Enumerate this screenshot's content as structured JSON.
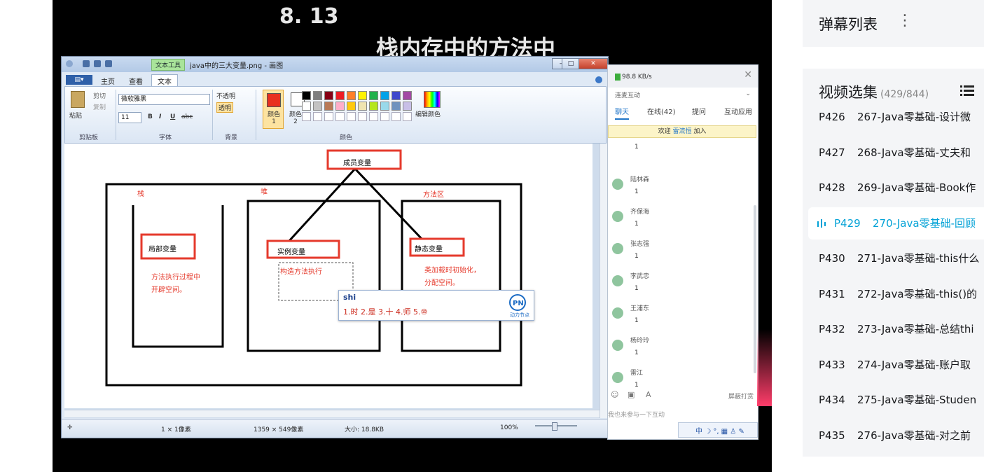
{
  "video": {
    "title_line1": "8. 13",
    "title_line2": "栈内存中的方法中",
    "paint": {
      "window_title": "java中的三大变量.png - 画图",
      "context_tab": "文本工具",
      "file_tab": "▤▾",
      "tabs": [
        "主页",
        "查看",
        "文本"
      ],
      "clipboard": {
        "paste": "粘贴",
        "cut": "剪切",
        "copy": "复制",
        "label": "剪贴板"
      },
      "font": {
        "family": "微软雅黑",
        "size": "11",
        "label": "字体",
        "bold": "B",
        "italic": "I",
        "underline": "U",
        "strike": "abc"
      },
      "background": {
        "opaque": "不透明",
        "transparent": "透明",
        "label": "背景"
      },
      "colors": {
        "color1": "颜色 1",
        "color2": "颜色 2",
        "edit": "编辑颜色",
        "label": "颜色",
        "palette": [
          "#000000",
          "#7f7f7f",
          "#880015",
          "#ed1c24",
          "#ff7f27",
          "#fff200",
          "#22b14c",
          "#00a2e8",
          "#3f48cc",
          "#a349a4",
          "#ffffff",
          "#c3c3c3",
          "#b97a57",
          "#ffaec9",
          "#ffc90e",
          "#efe4b0",
          "#b5e61d",
          "#99d9ea",
          "#7092be",
          "#c8bfe7"
        ]
      },
      "diagram": {
        "member": "成员变量",
        "stack": "栈",
        "heap": "堆",
        "method_area": "方法区",
        "local": "局部变量",
        "instance": "实例变量",
        "static": "静态变量",
        "local_desc1": "方法执行过程中",
        "local_desc2": "开辟空间。",
        "instance_desc": "构造方法执行",
        "static_desc1": "类加载时初始化，",
        "static_desc2": "分配空间。"
      },
      "ime": {
        "pinyin": "shi",
        "candidates": "1.时  2.是  3.十  4.师  5.⑩",
        "brand": "动力节点"
      },
      "status": {
        "pos": "1 × 1像素",
        "size": "1359 × 549像素",
        "file": "大小: 18.8KB",
        "zoom": "100%"
      }
    },
    "chat": {
      "speed": "98.8 KB/s",
      "subtitle": "连麦互动",
      "tabs": [
        "聊天",
        "在线(42)",
        "提问",
        "互动应用"
      ],
      "welcome_pre": "欢迎",
      "welcome_name": "雷流恒",
      "welcome_post": "加入",
      "messages": [
        {
          "name": "",
          "text": "1"
        },
        {
          "name": "陆林森",
          "text": "1"
        },
        {
          "name": "齐保海",
          "text": "1"
        },
        {
          "name": "张志强",
          "text": "1"
        },
        {
          "name": "李武忠",
          "text": "1"
        },
        {
          "name": "王浦东",
          "text": "1"
        },
        {
          "name": "杨玲玲",
          "text": "1"
        },
        {
          "name": "雷江",
          "text": "1"
        }
      ],
      "block_label": "屏蔽打赏",
      "input_placeholder": "我也来参与一下互动",
      "bottom": "中 ☽ °, ▦ ♙ ✎"
    }
  },
  "sidebar": {
    "danmu_title": "弹幕列表",
    "menu_icon": "⋮",
    "episodes_title": "视频选集",
    "episodes_count": "(429/844)",
    "episodes": [
      {
        "p": "P426",
        "name": "267-Java零基础-设计微"
      },
      {
        "p": "P427",
        "name": "268-Java零基础-丈夫和"
      },
      {
        "p": "P428",
        "name": "269-Java零基础-Book作"
      },
      {
        "p": "P429",
        "name": "270-Java零基础-回顾",
        "current": true
      },
      {
        "p": "P430",
        "name": "271-Java零基础-this什么"
      },
      {
        "p": "P431",
        "name": "272-Java零基础-this()的"
      },
      {
        "p": "P432",
        "name": "273-Java零基础-总结thi"
      },
      {
        "p": "P433",
        "name": "274-Java零基础-账户取"
      },
      {
        "p": "P434",
        "name": "275-Java零基础-Studen"
      },
      {
        "p": "P435",
        "name": "276-Java零基础-对之前"
      }
    ]
  }
}
